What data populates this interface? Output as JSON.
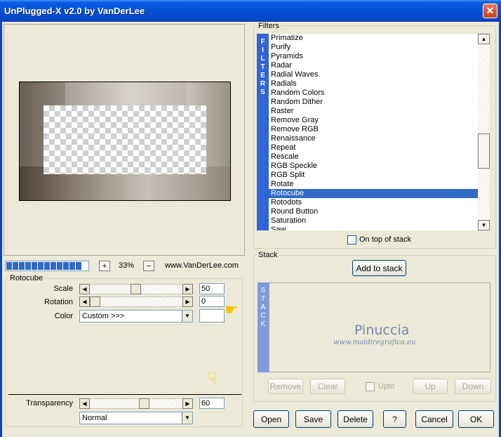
{
  "window": {
    "title": "UnPlugged-X v2.0 by VanDerLee",
    "close_label": "✕"
  },
  "preview": {
    "zoom": "33%",
    "website": "www.VanDerLee.com",
    "zoom_in": "+",
    "zoom_out": "−"
  },
  "params": {
    "group_title": "Rotocube",
    "scale": {
      "label": "Scale",
      "value": "50"
    },
    "rotation": {
      "label": "Rotation",
      "value": "0"
    },
    "color": {
      "label": "Color",
      "selected": "Custom >>>"
    },
    "transparency": {
      "label": "Transparency",
      "value": "60"
    },
    "blend_mode": "Normal"
  },
  "filters": {
    "group_title": "Filters",
    "tab_label": "FILTERS",
    "items": [
      "Primatize",
      "Purify",
      "Pyramids",
      "Radar",
      "Radial Waves",
      "Radials",
      "Random Colors",
      "Random Dither",
      "Raster",
      "Remove Gray",
      "Remove RGB",
      "Renaissance",
      "Repeat",
      "Rescale",
      "RGB Speckle",
      "RGB Split",
      "Rotate",
      "Rotocube",
      "Rotodots",
      "Round Button",
      "Saturation",
      "Saw"
    ],
    "selected": "Rotocube",
    "on_top_label": "On top of stack"
  },
  "stack": {
    "group_title": "Stack",
    "tab_label": "STACK",
    "add_label": "Add to stack",
    "remove_label": "Remove",
    "clear_label": "Clear",
    "upto_label": "Upto",
    "up_label": "Up",
    "down_label": "Down"
  },
  "watermark": {
    "name": "Pinuccia",
    "site": "www.maidiregrafica.eu"
  },
  "buttons": {
    "open": "Open",
    "save": "Save",
    "delete": "Delete",
    "help": "?",
    "cancel": "Cancel",
    "ok": "OK"
  },
  "colors": {
    "title_bar": "#0452d6",
    "selection": "#316ac5",
    "filters_tab": "#3065d7",
    "stack_tab": "#7e9ad8"
  }
}
